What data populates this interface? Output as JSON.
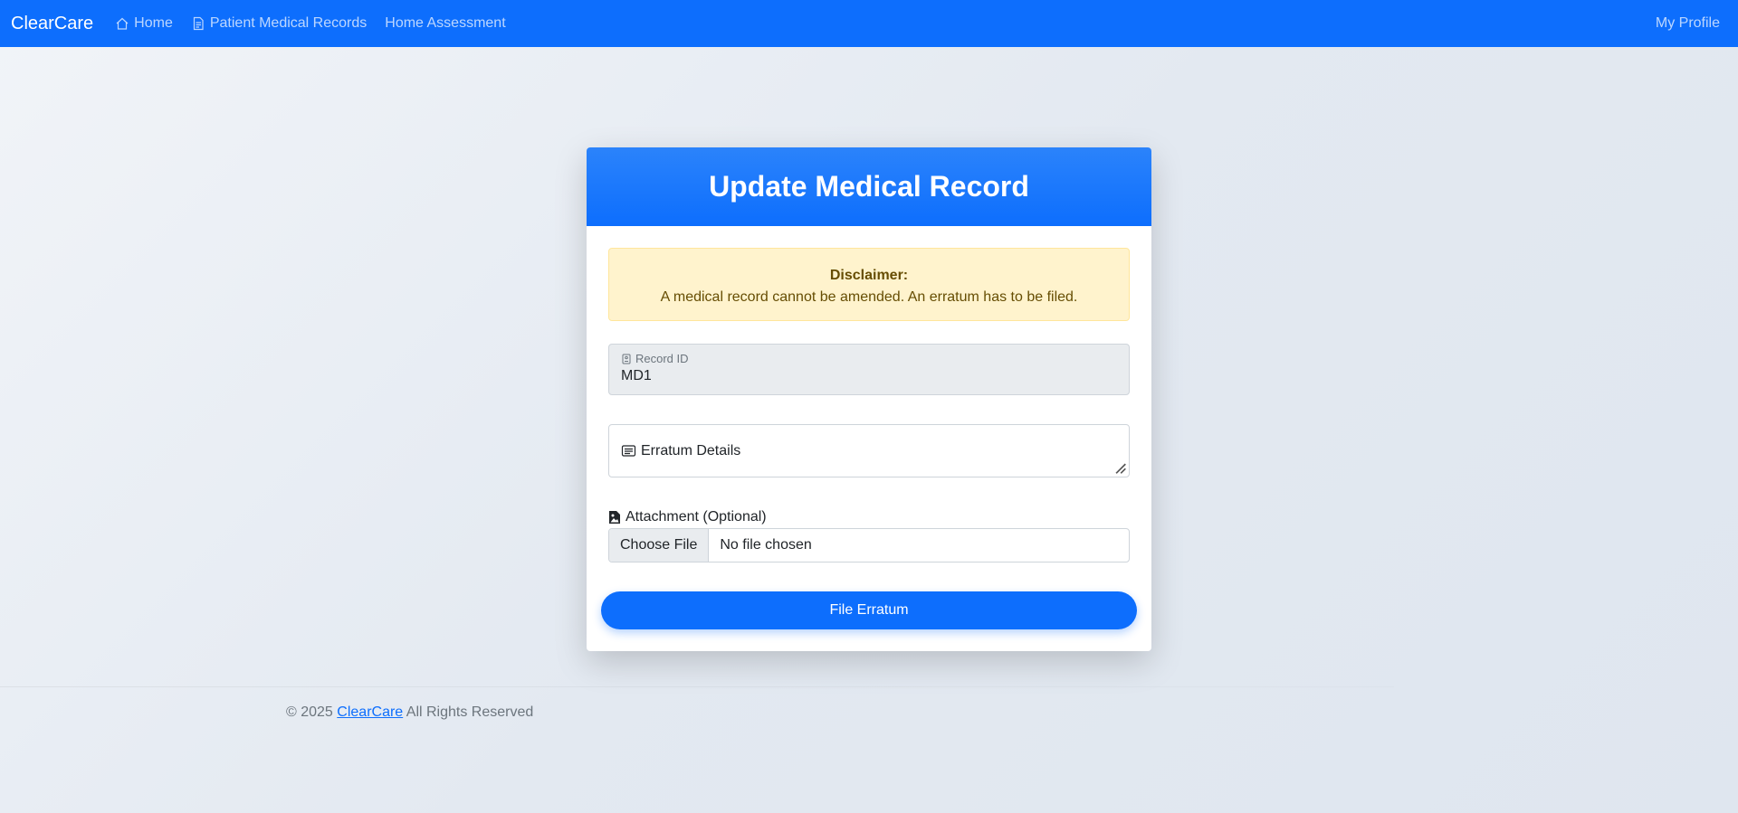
{
  "navbar": {
    "brand": "ClearCare",
    "links": [
      {
        "label": "Home",
        "icon": "house-icon"
      },
      {
        "label": "Patient Medical Records",
        "icon": "document-icon"
      },
      {
        "label": "Home Assessment",
        "icon": ""
      }
    ],
    "profile": "My Profile"
  },
  "card": {
    "title": "Update Medical Record",
    "disclaimer": {
      "heading": "Disclaimer:",
      "text": "A medical record cannot be amended. An erratum has to be filed."
    },
    "record_id": {
      "label": "Record ID",
      "value": "MD1",
      "icon": "id-card-icon"
    },
    "erratum": {
      "placeholder": "Erratum Details",
      "icon": "message-icon"
    },
    "attachment": {
      "label": "Attachment (Optional)",
      "icon": "image-file-icon",
      "button": "Choose File",
      "status": "No file chosen"
    },
    "submit": "File Erratum"
  },
  "footer": {
    "prefix": "© 2025",
    "link": "ClearCare",
    "suffix": "All Rights Reserved"
  },
  "colors": {
    "primary": "#0d6efd",
    "alert_bg": "#fff3cd",
    "alert_text": "#664d03"
  }
}
